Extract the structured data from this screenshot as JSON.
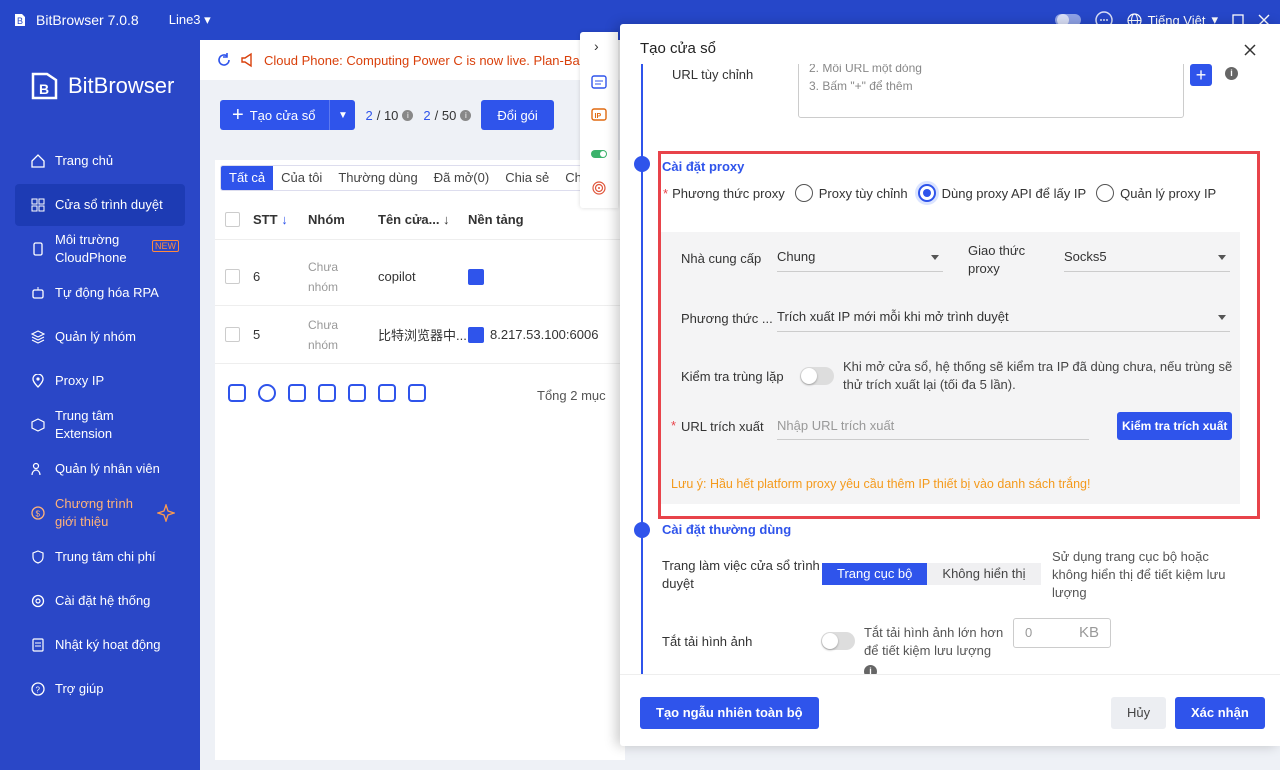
{
  "app": {
    "title": "BitBrowser 7.0.8",
    "line": "Line3",
    "language": "Tiếng Việt",
    "brand": "BitBrowser"
  },
  "sidebar": {
    "items": [
      {
        "label": "Trang chủ",
        "icon": "home-icon"
      },
      {
        "label": "Cửa sổ trình duyệt",
        "icon": "grid-icon"
      },
      {
        "label": "Môi trường CloudPhone",
        "icon": "phone-icon",
        "badge": "NEW"
      },
      {
        "label": "Tự động hóa RPA",
        "icon": "robot-icon"
      },
      {
        "label": "Quản lý nhóm",
        "icon": "layers-icon"
      },
      {
        "label": "Proxy IP",
        "icon": "location-icon"
      },
      {
        "label": "Trung tâm Extension",
        "icon": "cube-icon"
      },
      {
        "label": "Quản lý nhân viên",
        "icon": "users-icon"
      },
      {
        "label": "Chương trình giới thiệu",
        "icon": "gift-icon"
      },
      {
        "label": "Trung tâm chi phí",
        "icon": "shield-icon"
      },
      {
        "label": "Cài đặt hệ thống",
        "icon": "gear-icon"
      },
      {
        "label": "Nhật ký hoạt động",
        "icon": "log-icon"
      },
      {
        "label": "Trợ giúp",
        "icon": "help-icon"
      }
    ]
  },
  "main": {
    "notice": "Cloud Phone: Computing Power C is now live. Plan-Bas",
    "create_button": "Tạo cửa sổ",
    "count1_used": "2",
    "count1_total": "/ 10",
    "count2_used": "2",
    "count2_total": "/ 50",
    "upgrade_button": "Đổi gói",
    "tabs": [
      "Tất cả",
      "Của tôi",
      "Thường dùng",
      "Đã mở(0)",
      "Chia sẻ",
      "Ch"
    ],
    "columns": {
      "stt": "STT",
      "group": "Nhóm",
      "name": "Tên cửa...",
      "platform": "Nền tảng"
    },
    "rows": [
      {
        "stt": "6",
        "group": "Chưa nhóm",
        "name": "copilot",
        "platform": ""
      },
      {
        "stt": "5",
        "group": "Chưa nhóm",
        "name": "比特浏览器中...",
        "platform": "8.217.53.100:6006"
      }
    ],
    "total": "Tổng 2 mục"
  },
  "drawer": {
    "title": "Tạo cửa sổ",
    "custom_url": {
      "label": "URL tùy chỉnh",
      "lines": [
        "2. Mỗi URL một dòng",
        "3. Bấm \"+\" để thêm"
      ]
    },
    "proxy": {
      "section_title": "Cài đặt proxy",
      "method_label": "Phương thức proxy",
      "options": [
        "Proxy tùy chỉnh",
        "Dùng proxy API để lấy IP",
        "Quản lý proxy IP"
      ],
      "provider_label": "Nhà cung cấp",
      "provider_value": "Chung",
      "protocol_label": "Giao thức proxy",
      "protocol_value": "Socks5",
      "method2_label": "Phương thức ...",
      "method2_value": "Trích xuất IP mới mỗi khi mở trình duyệt",
      "dup_label": "Kiểm tra trùng lặp",
      "dup_hint": "Khi mở cửa sổ, hệ thống sẽ kiểm tra IP đã dùng chưa, nếu trùng sẽ thử trích xuất lại (tối đa 5 lần).",
      "url_label": "URL trích xuất",
      "url_placeholder": "Nhập URL trích xuất",
      "check_button": "Kiểm tra trích xuất",
      "warning": "Lưu ý: Hầu hết platform proxy yêu cầu thêm IP thiết bị vào danh sách trắng!"
    },
    "common": {
      "section_title": "Cài đặt thường dùng",
      "workspace_label": "Trang làm việc cửa sổ trình duyệt",
      "seg_local": "Trang cục bộ",
      "seg_hide": "Không hiển thị",
      "workspace_hint": "Sử dụng trang cục bộ hoặc không hiển thị để tiết kiệm lưu lượng",
      "image_label": "Tắt tải hình ảnh",
      "image_hint": "Tắt tải hình ảnh lớn hơn để tiết kiệm lưu lượng",
      "kb_value": "0",
      "kb_unit": "KB"
    },
    "footer": {
      "random": "Tạo ngẫu nhiên toàn bộ",
      "cancel": "Hủy",
      "confirm": "Xác nhận"
    }
  }
}
